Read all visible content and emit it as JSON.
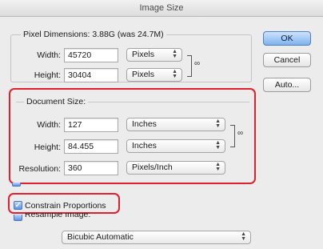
{
  "window": {
    "title": "Image Size"
  },
  "pixel_dimensions": {
    "legend": "Pixel Dimensions:",
    "size_text": "3.88G (was 24.7M)",
    "width_label": "Width:",
    "width_value": "45720",
    "width_unit": "Pixels",
    "height_label": "Height:",
    "height_value": "30404",
    "height_unit": "Pixels"
  },
  "buttons": {
    "ok": "OK",
    "cancel": "Cancel",
    "auto": "Auto..."
  },
  "document_size": {
    "legend": "Document Size:",
    "width_label": "Width:",
    "width_value": "127",
    "width_unit": "Inches",
    "height_label": "Height:",
    "height_value": "84.455",
    "height_unit": "Inches",
    "resolution_label": "Resolution:",
    "resolution_value": "360",
    "resolution_unit": "Pixels/Inch"
  },
  "options": {
    "constrain_proportions": {
      "label": "Constrain Proportions",
      "checked": true
    },
    "resample_image": {
      "label": "Resample Image:",
      "checked": true
    },
    "resample_method": "Bicubic Automatic"
  },
  "icons": {
    "chain": "link-icon",
    "select_arrows": "updown-arrows-icon",
    "checkmark": "checkmark-icon"
  },
  "colors": {
    "highlight": "#e2202d",
    "default_button": "#7fb1ee",
    "background": "#ececec"
  }
}
